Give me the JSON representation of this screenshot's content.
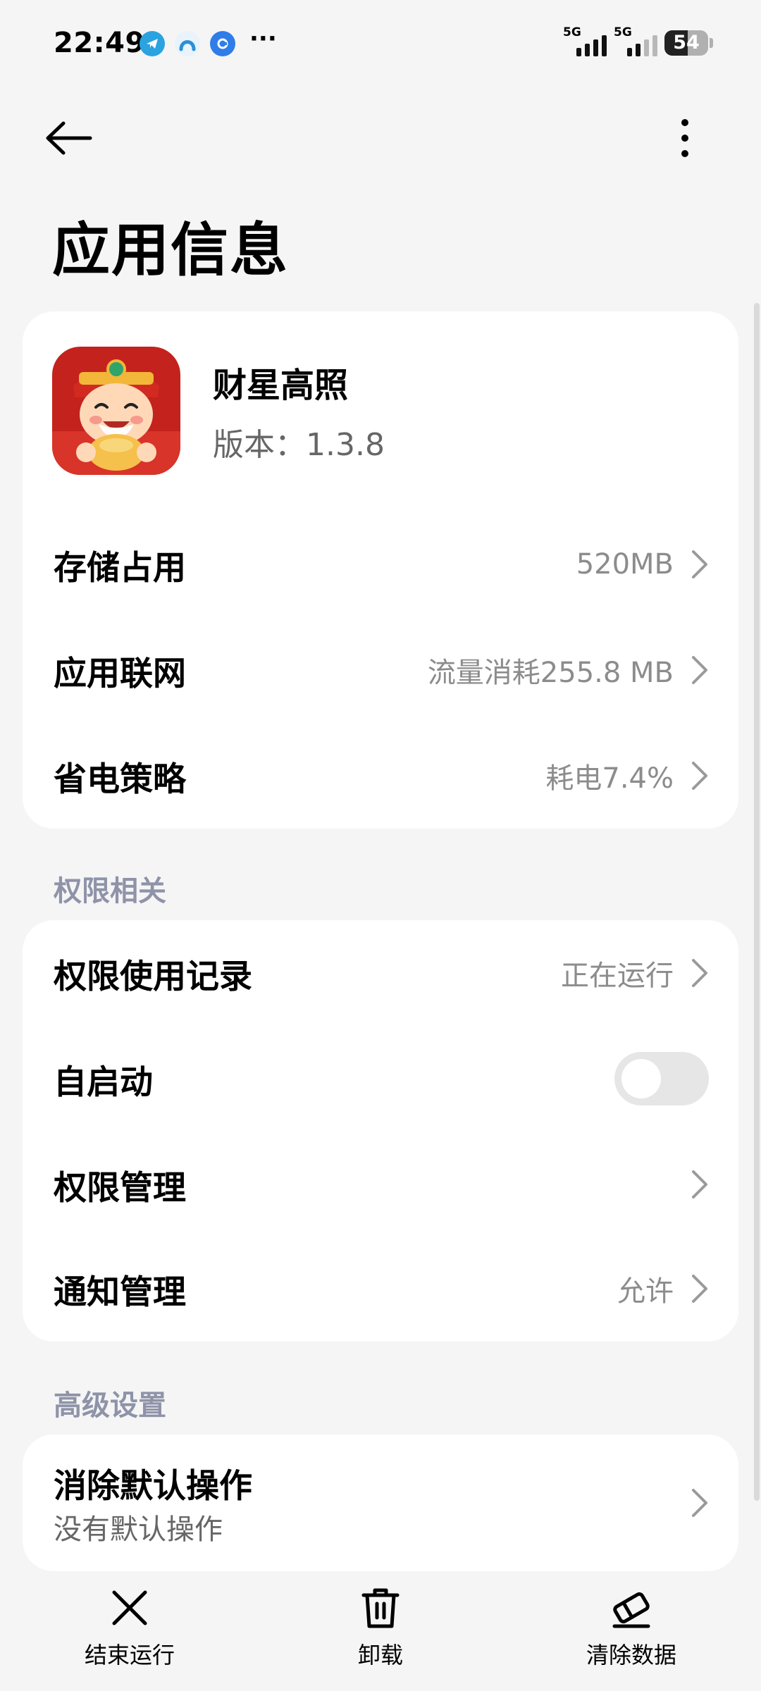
{
  "status_bar": {
    "time": "22:49",
    "signal1_label": "5G",
    "signal2_label": "5G",
    "battery_text": "54",
    "battery_level": 0.54,
    "notification_icons": [
      "telegram-icon",
      "app-arc-icon",
      "app-blue-icon"
    ],
    "more_label": "···"
  },
  "header": {
    "title": "应用信息"
  },
  "app": {
    "name": "财星高照",
    "version": "版本：1.3.8"
  },
  "info_rows": [
    {
      "label": "存储占用",
      "value": "520MB"
    },
    {
      "label": "应用联网",
      "value": "流量消耗255.8 MB"
    },
    {
      "label": "省电策略",
      "value": "耗电7.4%"
    }
  ],
  "permissions_section": {
    "title": "权限相关",
    "rows": [
      {
        "label": "权限使用记录",
        "value": "正在运行"
      },
      {
        "label": "自启动",
        "toggle_on": false
      },
      {
        "label": "权限管理",
        "value": ""
      },
      {
        "label": "通知管理",
        "value": "允许"
      }
    ]
  },
  "advanced_section": {
    "title": "高级设置",
    "rows": [
      {
        "label": "消除默认操作",
        "subtitle": "没有默认操作"
      }
    ]
  },
  "bottom_bar": {
    "items": [
      {
        "label": "结束运行",
        "icon": "close-icon"
      },
      {
        "label": "卸载",
        "icon": "trash-icon"
      },
      {
        "label": "清除数据",
        "icon": "eraser-icon"
      }
    ]
  },
  "colors": {
    "background": "#f5f5f5",
    "card": "#ffffff",
    "section_title": "#8e93a8",
    "secondary_text": "#8c8c8c"
  }
}
